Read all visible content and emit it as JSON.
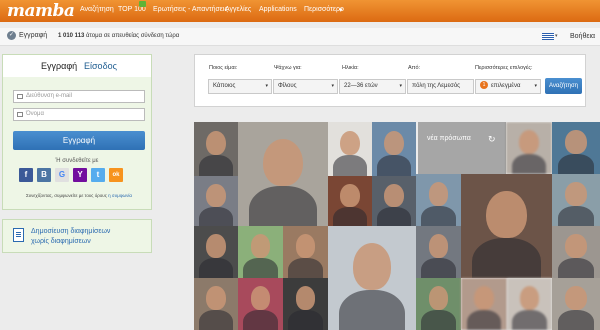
{
  "nav": {
    "logo": "mamba",
    "items": [
      "Αναζήτηση",
      "TOP 100",
      "Ερωτήσεις - Απαντήσεις",
      "Αγγελίες",
      "Applications",
      "Περισσότερο"
    ],
    "more_caret": "▾"
  },
  "subbar": {
    "register_label": "Εγγραφή",
    "online_count": "1 010 113",
    "online_text": "άτομα σε απευθείας σύνδεση τώρα",
    "help_label": "Βοήθεια",
    "flag_caret": "▾"
  },
  "login_panel": {
    "tab_register": "Εγγραφή",
    "tab_login": "Είσοδος",
    "email_placeholder": "Διεύθυνση e-mail",
    "name_placeholder": "Όνομα",
    "submit_label": "Εγγραφή",
    "connect_text": "Ή συνδεθείτε με",
    "social_icons": [
      "facebook-icon",
      "vk-icon",
      "google-icon",
      "yahoo-icon",
      "twitter-icon",
      "odnoklassniki-icon"
    ],
    "social_glyphs": [
      "f",
      "B",
      "G",
      "Y",
      "t",
      "ok"
    ],
    "terms_text": "Συνεχίζοντας, συμφωνείτε με τους όρους ",
    "terms_link": "η συμφωνία"
  },
  "ad_panel": {
    "line1": "Δημοσίευση διαφημίσεων",
    "line2": "χωρίς διαφημίσεων"
  },
  "search": {
    "labels": [
      "Ποιος είμαι:",
      "Ψάχνω για:",
      "Ηλικία:",
      "Από:",
      "Περισσότερες επιλογές:"
    ],
    "i_am": "Κάποιος",
    "looking_for": "Φίλους",
    "age": "22—36 ετών",
    "from": "πόλη της Λεμεσός",
    "options_count": "1",
    "options_label": "επιλεγμένα",
    "button_label": "Αναζήτηση",
    "caret": "▾"
  },
  "grid": {
    "new_here_label": "νέα πρόσωπα",
    "refresh_glyph": "↻"
  },
  "colors": {
    "brand_orange": "#e57a20",
    "link_blue": "#2a6ab0",
    "button_blue": "#3a7ec3",
    "panel_green": "#eef6e6"
  }
}
